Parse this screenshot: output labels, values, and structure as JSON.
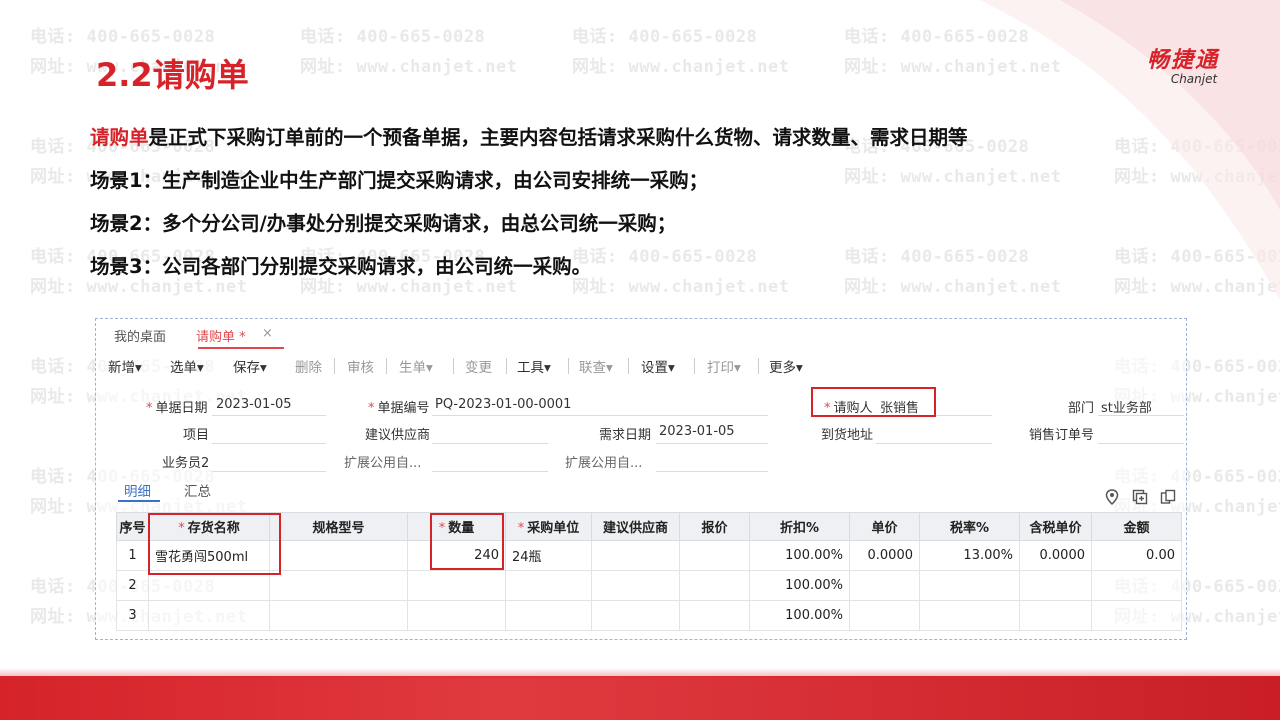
{
  "watermark": {
    "phone": "电话: 400-665-0028",
    "site": "网址: www.chanjet.net"
  },
  "slide": {
    "title": "2.2请购单",
    "logo_cn": "畅捷通",
    "logo_en": "Chanjet",
    "intro_highlight": "请购单",
    "intro_rest": "是正式下采购订单前的一个预备单据，主要内容包括请求采购什么货物、请求数量、需求日期等",
    "scene1": "场景1：生产制造企业中生产部门提交采购请求，由公司安排统一采购；",
    "scene2": "场景2：多个分公司/办事处分别提交采购请求，由总公司统一采购；",
    "scene3": "场景3：公司各部门分别提交采购请求，由公司统一采购。"
  },
  "app": {
    "tabs": {
      "desk": "我的桌面",
      "active": "请购单 *",
      "close": "×"
    },
    "toolbar": {
      "add": "新增▾",
      "select": "选单▾",
      "save": "保存▾",
      "delete": "删除",
      "audit": "审核",
      "gen": "生单▾",
      "change": "变更",
      "tools": "工具▾",
      "query": "联查▾",
      "settings": "设置▾",
      "print": "打印▾",
      "more": "更多▾"
    },
    "form": {
      "date_label": "单据日期",
      "date_value": "2023-01-05",
      "no_label": "单据编号",
      "no_value": "PQ-2023-01-00-0001",
      "requester_label": "请购人",
      "requester_value": "张销售",
      "dept_label": "部门",
      "dept_value": "st业务部",
      "project_label": "项目",
      "supplier_label": "建议供应商",
      "need_date_label": "需求日期",
      "need_date_value": "2023-01-05",
      "address_label": "到货地址",
      "so_label": "销售订单号",
      "salesman_label": "业务员2",
      "ext1_label": "扩展公用自...",
      "ext2_label": "扩展公用自..."
    },
    "subtabs": {
      "detail": "明细",
      "summary": "汇总"
    },
    "grid": {
      "headers": [
        "序号",
        "存货名称",
        "规格型号",
        "数量",
        "采购单位",
        "建议供应商",
        "报价",
        "折扣%",
        "单价",
        "税率%",
        "含税单价",
        "金额"
      ],
      "rows": [
        [
          "1",
          "雪花勇闯500ml",
          "",
          "240",
          "24瓶",
          "",
          "",
          "100.00%",
          "0.0000",
          "13.00%",
          "0.0000",
          "0.00"
        ],
        [
          "2",
          "",
          "",
          "",
          "",
          "",
          "",
          "100.00%",
          "",
          "",
          "",
          ""
        ],
        [
          "3",
          "",
          "",
          "",
          "",
          "",
          "",
          "100.00%",
          "",
          "",
          "",
          ""
        ]
      ]
    }
  }
}
